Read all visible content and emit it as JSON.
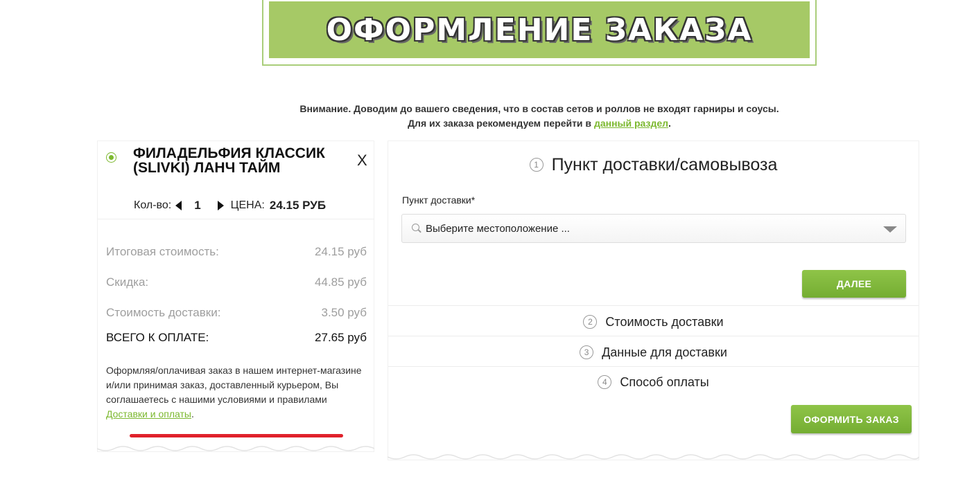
{
  "header": {
    "title": "ОФОРМЛЕНИЕ ЗАКАЗА"
  },
  "notice": {
    "line1": "Внимание. Доводим до вашего сведения, что в состав сетов и роллов не входят гарниры и соусы.",
    "line2_prefix": "Для их заказа рекомендуем перейти в ",
    "line2_link": "данный раздел",
    "line2_suffix": "."
  },
  "cart": {
    "item_name": "Филадельфия классик (SLIVKI) ЛАНЧ ТАЙМ",
    "remove_label": "X",
    "qty_label": "Кол-во:",
    "qty": "1",
    "price_label": "ЦЕНА:",
    "price": "24.15 РУБ",
    "summary": [
      {
        "label": "Итоговая стоимость:",
        "value": "24.15 руб"
      },
      {
        "label": "Скидка:",
        "value": "44.85 руб"
      },
      {
        "label": "Стоимость доставки:",
        "value": "3.50 руб"
      },
      {
        "label": "ВСЕГО К ОПЛАТЕ:",
        "value": "27.65 руб"
      }
    ],
    "terms_text": "Оформляя/оплачивая заказ в нашем интернет-магазине и/или принимая заказ, доставленный курьером, Вы соглашаетесь с нашими условиями и правилами ",
    "terms_link": "Доставки и оплаты",
    "terms_suffix": "."
  },
  "checkout": {
    "steps": [
      {
        "num": "1",
        "title": "Пункт доставки/самовывоза"
      },
      {
        "num": "2",
        "title": "Стоимость доставки"
      },
      {
        "num": "3",
        "title": "Данные для доставки"
      },
      {
        "num": "4",
        "title": "Способ оплаты"
      }
    ],
    "field_label": "Пункт доставки*",
    "select_placeholder": "Выберите местоположение ...",
    "next_button": "ДАЛЕЕ",
    "order_button": "ОФОРМИТЬ ЗАКАЗ"
  },
  "colors": {
    "accent": "#7cb82f",
    "banner": "#a6c966",
    "underline_mark": "#e0212b"
  }
}
